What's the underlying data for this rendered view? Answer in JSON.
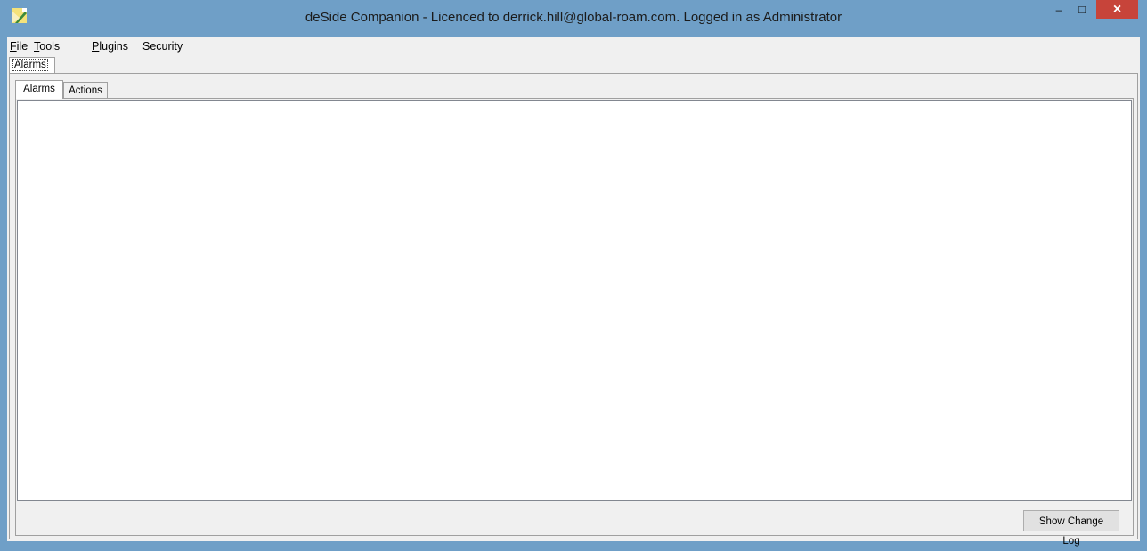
{
  "window": {
    "title": "deSide Companion - Licenced to derrick.hill@global-roam.com. Logged in as Administrator",
    "icon": "app-icon",
    "controls": {
      "minimize": "–",
      "maximize": "□",
      "close": "×"
    },
    "accent_color": "#6f9fc7",
    "close_color": "#c7443a"
  },
  "menu": {
    "file": {
      "mnemonic": "F",
      "rest": "ile"
    },
    "tools": {
      "mnemonic": "T",
      "rest": "ools"
    },
    "plugins": {
      "mnemonic": "P",
      "rest": "lugins"
    },
    "security": {
      "label": "Security"
    }
  },
  "outer_tabs": {
    "alarms": "Alarms"
  },
  "inner_tabs": {
    "alarms": "Alarms",
    "actions": "Actions"
  },
  "footer": {
    "show_change_log": "Show Change Log"
  }
}
